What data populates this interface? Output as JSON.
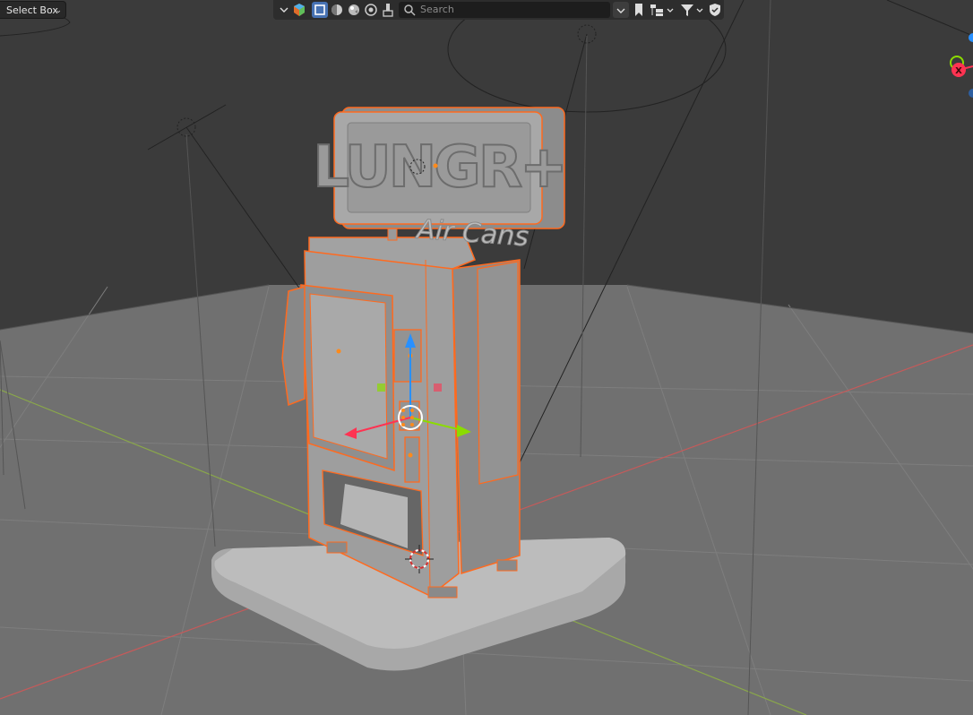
{
  "header": {
    "select_mode_label": "Select Box",
    "search_placeholder": "Search"
  },
  "scene": {
    "sign_text": "LUNGR+",
    "sign_subtitle": "Air Cans",
    "gizmo_x_label": "X"
  },
  "colors": {
    "viewport_bg": "#3d3d3d",
    "selection_outline": "#ff6a1f",
    "axis_x": "#ff3352",
    "axis_y": "#8bdc00",
    "axis_z": "#2890ff"
  },
  "icons": {
    "editor_dropdown": "chevron-down-icon",
    "editor_type": "editor-type-icon",
    "shading_modes": [
      "wireframe-icon",
      "solid-icon",
      "material-preview-icon",
      "rendered-icon"
    ],
    "brush": "brush-icon",
    "bookmark": "bookmark-icon",
    "hierarchy": "hierarchy-icon",
    "filter": "filter-icon",
    "shield": "shield-icon"
  }
}
